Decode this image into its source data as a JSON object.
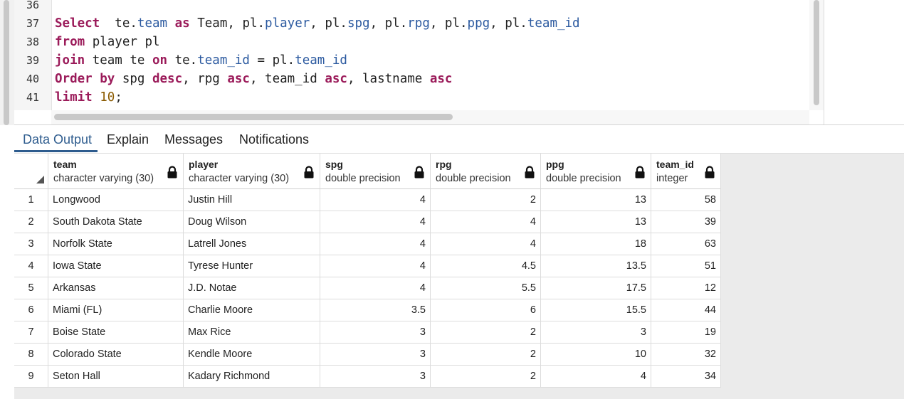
{
  "editor": {
    "line_numbers": [
      "36",
      "37",
      "38",
      "39",
      "40",
      "41"
    ],
    "lines": [
      [],
      [
        {
          "t": "Select",
          "c": "kw"
        },
        {
          "t": "  te.",
          "c": ""
        },
        {
          "t": "team",
          "c": "fld"
        },
        {
          "t": " ",
          "c": ""
        },
        {
          "t": "as",
          "c": "kw"
        },
        {
          "t": " Team, pl.",
          "c": ""
        },
        {
          "t": "player",
          "c": "fld"
        },
        {
          "t": ", pl.",
          "c": ""
        },
        {
          "t": "spg",
          "c": "fld"
        },
        {
          "t": ", pl.",
          "c": ""
        },
        {
          "t": "rpg",
          "c": "fld"
        },
        {
          "t": ", pl.",
          "c": ""
        },
        {
          "t": "ppg",
          "c": "fld"
        },
        {
          "t": ", pl.",
          "c": ""
        },
        {
          "t": "team_id",
          "c": "fld"
        }
      ],
      [
        {
          "t": "from",
          "c": "kw"
        },
        {
          "t": " player pl",
          "c": ""
        }
      ],
      [
        {
          "t": "join",
          "c": "kw"
        },
        {
          "t": " team te ",
          "c": ""
        },
        {
          "t": "on",
          "c": "kw"
        },
        {
          "t": " te.",
          "c": ""
        },
        {
          "t": "team_id",
          "c": "fld"
        },
        {
          "t": " = pl.",
          "c": ""
        },
        {
          "t": "team_id",
          "c": "fld"
        }
      ],
      [
        {
          "t": "Order by",
          "c": "kw"
        },
        {
          "t": " spg ",
          "c": ""
        },
        {
          "t": "desc",
          "c": "kw"
        },
        {
          "t": ", rpg ",
          "c": ""
        },
        {
          "t": "asc",
          "c": "kw"
        },
        {
          "t": ", team_id ",
          "c": ""
        },
        {
          "t": "asc",
          "c": "kw"
        },
        {
          "t": ", lastname ",
          "c": ""
        },
        {
          "t": "asc",
          "c": "kw"
        }
      ],
      [
        {
          "t": "limit",
          "c": "kw"
        },
        {
          "t": " ",
          "c": ""
        },
        {
          "t": "10",
          "c": "num"
        },
        {
          "t": ";",
          "c": ""
        }
      ]
    ]
  },
  "tabs": [
    {
      "label": "Data Output",
      "active": true
    },
    {
      "label": "Explain",
      "active": false
    },
    {
      "label": "Messages",
      "active": false
    },
    {
      "label": "Notifications",
      "active": false
    }
  ],
  "grid": {
    "columns": [
      {
        "name": "team",
        "type": "character varying (30)",
        "align": "left",
        "icon": "lock-icon"
      },
      {
        "name": "player",
        "type": "character varying (30)",
        "align": "left",
        "icon": "lock-icon"
      },
      {
        "name": "spg",
        "type": "double precision",
        "align": "right",
        "icon": "lock-icon"
      },
      {
        "name": "rpg",
        "type": "double precision",
        "align": "right",
        "icon": "lock-icon"
      },
      {
        "name": "ppg",
        "type": "double precision",
        "align": "right",
        "icon": "lock-icon"
      },
      {
        "name": "team_id",
        "type": "integer",
        "align": "right",
        "icon": "lock-icon"
      }
    ],
    "rows": [
      {
        "n": "1",
        "cells": [
          "Longwood",
          "Justin Hill",
          "4",
          "2",
          "13",
          "58"
        ]
      },
      {
        "n": "2",
        "cells": [
          "South Dakota State",
          "Doug Wilson",
          "4",
          "4",
          "13",
          "39"
        ]
      },
      {
        "n": "3",
        "cells": [
          "Norfolk State",
          "Latrell Jones",
          "4",
          "4",
          "18",
          "63"
        ]
      },
      {
        "n": "4",
        "cells": [
          "Iowa State",
          "Tyrese Hunter",
          "4",
          "4.5",
          "13.5",
          "51"
        ]
      },
      {
        "n": "5",
        "cells": [
          "Arkansas",
          "J.D. Notae",
          "4",
          "5.5",
          "17.5",
          "12"
        ]
      },
      {
        "n": "6",
        "cells": [
          "Miami (FL)",
          "Charlie Moore",
          "3.5",
          "6",
          "15.5",
          "44"
        ]
      },
      {
        "n": "7",
        "cells": [
          "Boise State",
          "Max Rice",
          "3",
          "2",
          "3",
          "19"
        ]
      },
      {
        "n": "8",
        "cells": [
          "Colorado State",
          "Kendle Moore",
          "3",
          "2",
          "10",
          "32"
        ]
      },
      {
        "n": "9",
        "cells": [
          "Seton Hall",
          "Kadary Richmond",
          "3",
          "2",
          "4",
          "34"
        ]
      }
    ]
  }
}
